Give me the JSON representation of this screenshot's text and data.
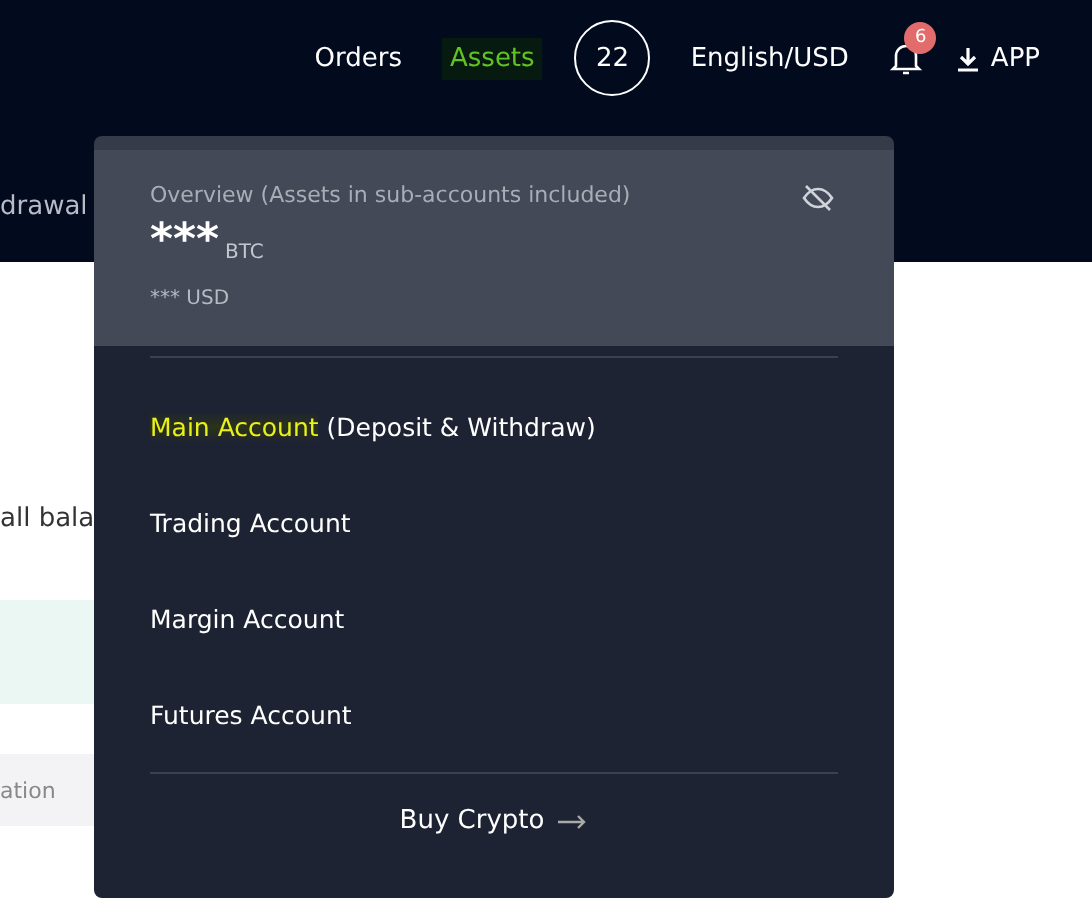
{
  "header": {
    "nav": [
      {
        "label": "Orders",
        "selected": false
      },
      {
        "label": "Assets",
        "selected": true
      }
    ],
    "avatar": "22",
    "language": "English/USD",
    "notifications": "6",
    "app": "APP"
  },
  "subnav": {
    "item": "drawal"
  },
  "page": {
    "text": "all bala",
    "table_header": "ation"
  },
  "dropdown": {
    "overview": {
      "title": "Overview (Assets in sub-accounts included)",
      "amount": "***",
      "unit": "BTC",
      "fiat": "*** USD"
    },
    "accounts": [
      {
        "name": "Main Account",
        "note": "(Deposit & Withdraw)",
        "selected": true
      },
      {
        "name": "Trading Account",
        "selected": false
      },
      {
        "name": "Margin Account",
        "selected": false
      },
      {
        "name": "Futures Account",
        "selected": false
      }
    ],
    "footer": "Buy Crypto"
  }
}
